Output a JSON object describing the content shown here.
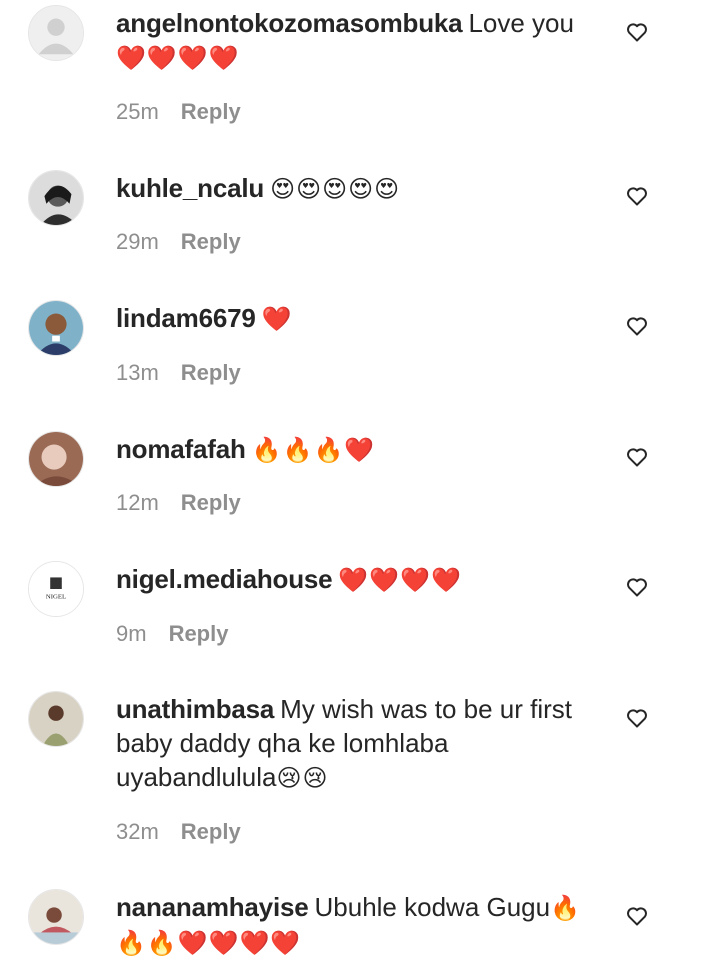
{
  "comments": [
    {
      "username": "angelnontokozomasombuka",
      "text": "Love you",
      "emoji": "❤️❤️❤️❤️",
      "time": "25m",
      "reply": "Reply"
    },
    {
      "username": "kuhle_ncalu",
      "text": "",
      "emoji": "😍😍😍😍😍",
      "time": "29m",
      "reply": "Reply"
    },
    {
      "username": "lindam6679",
      "text": "",
      "emoji": "❤️",
      "time": "13m",
      "reply": "Reply"
    },
    {
      "username": "nomafafah",
      "text": "",
      "emoji": "🔥🔥🔥❤️",
      "time": "12m",
      "reply": "Reply"
    },
    {
      "username": "nigel.mediahouse",
      "text": "",
      "emoji": "❤️❤️❤️❤️",
      "time": "9m",
      "reply": "Reply",
      "avatar_logo_text": "NIGEL"
    },
    {
      "username": "unathimbasa",
      "text": "My wish was to be ur first baby daddy qha ke lomhlaba uyabandlulula",
      "emoji": "😢😢",
      "time": "32m",
      "reply": "Reply"
    },
    {
      "username": "nananamhayise",
      "text": "Ubuhle kodwa Gugu",
      "emoji": "🔥🔥🔥❤️❤️❤️❤️",
      "time": "",
      "reply": ""
    }
  ],
  "icons": {
    "like": "heart-outline-icon",
    "default_avatar": "default-avatar-icon"
  },
  "colors": {
    "text": "#262626",
    "meta": "#8e8e8e",
    "background": "#ffffff"
  }
}
